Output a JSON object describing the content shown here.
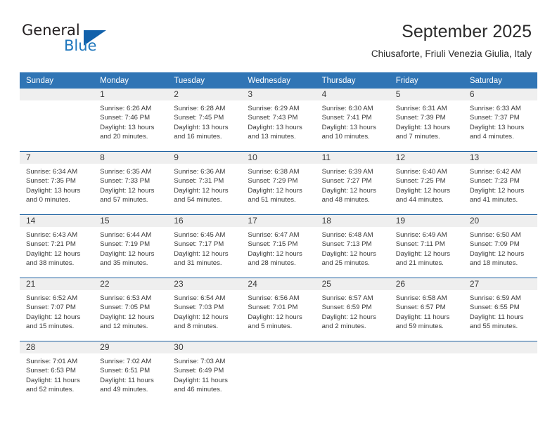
{
  "brand": {
    "name_top": "General",
    "name_bottom": "Blue",
    "accent_color": "#1161ab",
    "text_color": "#231f20"
  },
  "header": {
    "title": "September 2025",
    "subtitle": "Chiusaforte, Friuli Venezia Giulia, Italy"
  },
  "calendar": {
    "header_bg": "#3075b5",
    "daynum_bg": "#efefef",
    "week_rule_color": "#1a5fa0",
    "weekday_headers": [
      "Sunday",
      "Monday",
      "Tuesday",
      "Wednesday",
      "Thursday",
      "Friday",
      "Saturday"
    ],
    "weeks": [
      [
        {
          "day": "",
          "sunrise": "",
          "sunset": "",
          "daylight1": "",
          "daylight2": ""
        },
        {
          "day": "1",
          "sunrise": "Sunrise: 6:26 AM",
          "sunset": "Sunset: 7:46 PM",
          "daylight1": "Daylight: 13 hours",
          "daylight2": "and 20 minutes."
        },
        {
          "day": "2",
          "sunrise": "Sunrise: 6:28 AM",
          "sunset": "Sunset: 7:45 PM",
          "daylight1": "Daylight: 13 hours",
          "daylight2": "and 16 minutes."
        },
        {
          "day": "3",
          "sunrise": "Sunrise: 6:29 AM",
          "sunset": "Sunset: 7:43 PM",
          "daylight1": "Daylight: 13 hours",
          "daylight2": "and 13 minutes."
        },
        {
          "day": "4",
          "sunrise": "Sunrise: 6:30 AM",
          "sunset": "Sunset: 7:41 PM",
          "daylight1": "Daylight: 13 hours",
          "daylight2": "and 10 minutes."
        },
        {
          "day": "5",
          "sunrise": "Sunrise: 6:31 AM",
          "sunset": "Sunset: 7:39 PM",
          "daylight1": "Daylight: 13 hours",
          "daylight2": "and 7 minutes."
        },
        {
          "day": "6",
          "sunrise": "Sunrise: 6:33 AM",
          "sunset": "Sunset: 7:37 PM",
          "daylight1": "Daylight: 13 hours",
          "daylight2": "and 4 minutes."
        }
      ],
      [
        {
          "day": "7",
          "sunrise": "Sunrise: 6:34 AM",
          "sunset": "Sunset: 7:35 PM",
          "daylight1": "Daylight: 13 hours",
          "daylight2": "and 0 minutes."
        },
        {
          "day": "8",
          "sunrise": "Sunrise: 6:35 AM",
          "sunset": "Sunset: 7:33 PM",
          "daylight1": "Daylight: 12 hours",
          "daylight2": "and 57 minutes."
        },
        {
          "day": "9",
          "sunrise": "Sunrise: 6:36 AM",
          "sunset": "Sunset: 7:31 PM",
          "daylight1": "Daylight: 12 hours",
          "daylight2": "and 54 minutes."
        },
        {
          "day": "10",
          "sunrise": "Sunrise: 6:38 AM",
          "sunset": "Sunset: 7:29 PM",
          "daylight1": "Daylight: 12 hours",
          "daylight2": "and 51 minutes."
        },
        {
          "day": "11",
          "sunrise": "Sunrise: 6:39 AM",
          "sunset": "Sunset: 7:27 PM",
          "daylight1": "Daylight: 12 hours",
          "daylight2": "and 48 minutes."
        },
        {
          "day": "12",
          "sunrise": "Sunrise: 6:40 AM",
          "sunset": "Sunset: 7:25 PM",
          "daylight1": "Daylight: 12 hours",
          "daylight2": "and 44 minutes."
        },
        {
          "day": "13",
          "sunrise": "Sunrise: 6:42 AM",
          "sunset": "Sunset: 7:23 PM",
          "daylight1": "Daylight: 12 hours",
          "daylight2": "and 41 minutes."
        }
      ],
      [
        {
          "day": "14",
          "sunrise": "Sunrise: 6:43 AM",
          "sunset": "Sunset: 7:21 PM",
          "daylight1": "Daylight: 12 hours",
          "daylight2": "and 38 minutes."
        },
        {
          "day": "15",
          "sunrise": "Sunrise: 6:44 AM",
          "sunset": "Sunset: 7:19 PM",
          "daylight1": "Daylight: 12 hours",
          "daylight2": "and 35 minutes."
        },
        {
          "day": "16",
          "sunrise": "Sunrise: 6:45 AM",
          "sunset": "Sunset: 7:17 PM",
          "daylight1": "Daylight: 12 hours",
          "daylight2": "and 31 minutes."
        },
        {
          "day": "17",
          "sunrise": "Sunrise: 6:47 AM",
          "sunset": "Sunset: 7:15 PM",
          "daylight1": "Daylight: 12 hours",
          "daylight2": "and 28 minutes."
        },
        {
          "day": "18",
          "sunrise": "Sunrise: 6:48 AM",
          "sunset": "Sunset: 7:13 PM",
          "daylight1": "Daylight: 12 hours",
          "daylight2": "and 25 minutes."
        },
        {
          "day": "19",
          "sunrise": "Sunrise: 6:49 AM",
          "sunset": "Sunset: 7:11 PM",
          "daylight1": "Daylight: 12 hours",
          "daylight2": "and 21 minutes."
        },
        {
          "day": "20",
          "sunrise": "Sunrise: 6:50 AM",
          "sunset": "Sunset: 7:09 PM",
          "daylight1": "Daylight: 12 hours",
          "daylight2": "and 18 minutes."
        }
      ],
      [
        {
          "day": "21",
          "sunrise": "Sunrise: 6:52 AM",
          "sunset": "Sunset: 7:07 PM",
          "daylight1": "Daylight: 12 hours",
          "daylight2": "and 15 minutes."
        },
        {
          "day": "22",
          "sunrise": "Sunrise: 6:53 AM",
          "sunset": "Sunset: 7:05 PM",
          "daylight1": "Daylight: 12 hours",
          "daylight2": "and 12 minutes."
        },
        {
          "day": "23",
          "sunrise": "Sunrise: 6:54 AM",
          "sunset": "Sunset: 7:03 PM",
          "daylight1": "Daylight: 12 hours",
          "daylight2": "and 8 minutes."
        },
        {
          "day": "24",
          "sunrise": "Sunrise: 6:56 AM",
          "sunset": "Sunset: 7:01 PM",
          "daylight1": "Daylight: 12 hours",
          "daylight2": "and 5 minutes."
        },
        {
          "day": "25",
          "sunrise": "Sunrise: 6:57 AM",
          "sunset": "Sunset: 6:59 PM",
          "daylight1": "Daylight: 12 hours",
          "daylight2": "and 2 minutes."
        },
        {
          "day": "26",
          "sunrise": "Sunrise: 6:58 AM",
          "sunset": "Sunset: 6:57 PM",
          "daylight1": "Daylight: 11 hours",
          "daylight2": "and 59 minutes."
        },
        {
          "day": "27",
          "sunrise": "Sunrise: 6:59 AM",
          "sunset": "Sunset: 6:55 PM",
          "daylight1": "Daylight: 11 hours",
          "daylight2": "and 55 minutes."
        }
      ],
      [
        {
          "day": "28",
          "sunrise": "Sunrise: 7:01 AM",
          "sunset": "Sunset: 6:53 PM",
          "daylight1": "Daylight: 11 hours",
          "daylight2": "and 52 minutes."
        },
        {
          "day": "29",
          "sunrise": "Sunrise: 7:02 AM",
          "sunset": "Sunset: 6:51 PM",
          "daylight1": "Daylight: 11 hours",
          "daylight2": "and 49 minutes."
        },
        {
          "day": "30",
          "sunrise": "Sunrise: 7:03 AM",
          "sunset": "Sunset: 6:49 PM",
          "daylight1": "Daylight: 11 hours",
          "daylight2": "and 46 minutes."
        },
        {
          "day": "",
          "sunrise": "",
          "sunset": "",
          "daylight1": "",
          "daylight2": ""
        },
        {
          "day": "",
          "sunrise": "",
          "sunset": "",
          "daylight1": "",
          "daylight2": ""
        },
        {
          "day": "",
          "sunrise": "",
          "sunset": "",
          "daylight1": "",
          "daylight2": ""
        },
        {
          "day": "",
          "sunrise": "",
          "sunset": "",
          "daylight1": "",
          "daylight2": ""
        }
      ]
    ]
  }
}
